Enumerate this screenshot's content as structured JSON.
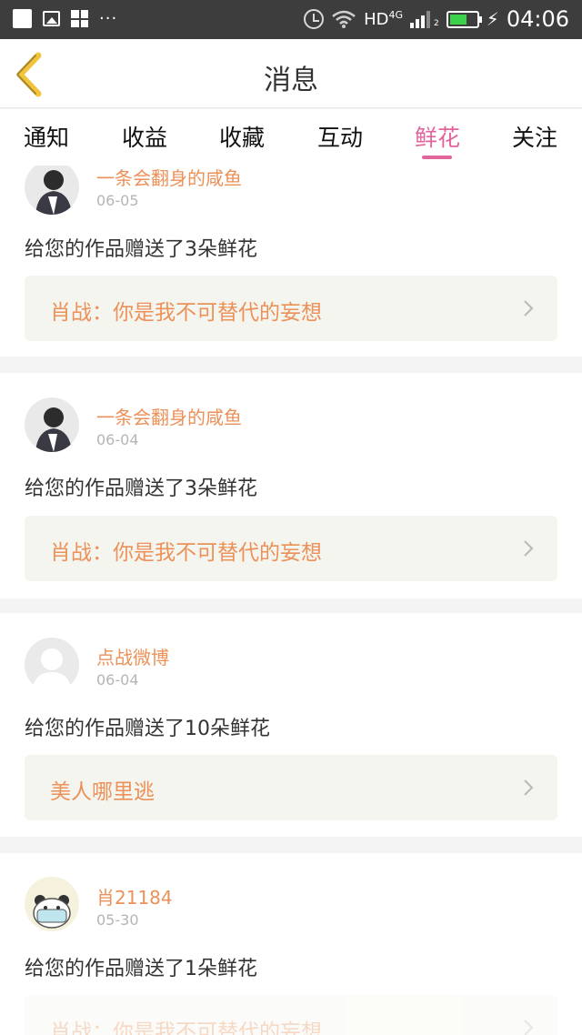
{
  "status_bar": {
    "icons_left": [
      "notification-square-icon",
      "image-icon",
      "apps-icon",
      "more-dots-icon"
    ],
    "more": "···",
    "network": "HD",
    "network_sup": "4G",
    "sim": "2",
    "battery_level": 0.65,
    "battery_color": "#3bd24a",
    "time": "04:06"
  },
  "header": {
    "title": "消息",
    "back_icon": "chevron-left-icon",
    "back_color": "#f2c43d"
  },
  "tabs": [
    {
      "label": "通知",
      "active": false
    },
    {
      "label": "收益",
      "active": false
    },
    {
      "label": "收藏",
      "active": false
    },
    {
      "label": "互动",
      "active": false
    },
    {
      "label": "鲜花",
      "active": true
    },
    {
      "label": "关注",
      "active": false
    }
  ],
  "accent_color": "#e1659d",
  "name_color": "#eb9159",
  "messages": [
    {
      "user": "一条会翻身的咸鱼",
      "date": "06-05",
      "text": "给您的作品赠送了3朵鲜花",
      "work": "肖战：你是我不可替代的妄想",
      "avatar": "person-photo-avatar"
    },
    {
      "user": "一条会翻身的咸鱼",
      "date": "06-04",
      "text": "给您的作品赠送了3朵鲜花",
      "work": "肖战：你是我不可替代的妄想",
      "avatar": "person-photo-avatar"
    },
    {
      "user": "点战微博",
      "date": "06-04",
      "text": "给您的作品赠送了10朵鲜花",
      "work": "美人哪里逃",
      "avatar": "default-avatar"
    },
    {
      "user": "肖21184",
      "date": "05-30",
      "text": "给您的作品赠送了1朵鲜花",
      "work": "肖战：你是我不可替代的妄想",
      "avatar": "cartoon-panda-avatar"
    }
  ]
}
